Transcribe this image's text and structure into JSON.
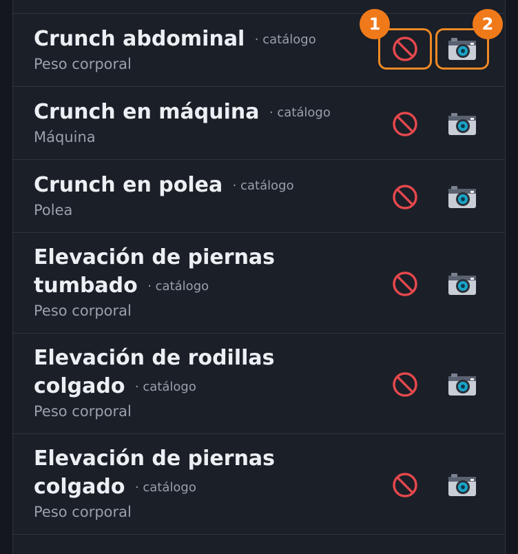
{
  "items": [
    {
      "title": "Crunch abdominal",
      "tag": "· catálogo",
      "sub": "Peso corporal"
    },
    {
      "title": "Crunch en máquina",
      "tag": "· catálogo",
      "sub": "Máquina"
    },
    {
      "title": "Crunch en polea",
      "tag": "· catálogo",
      "sub": "Polea"
    },
    {
      "title": "Elevación de piernas tumbado",
      "tag": "· catálogo",
      "sub": "Peso corporal"
    },
    {
      "title": "Elevación de rodillas colgado",
      "tag": "· catálogo",
      "sub": "Peso corporal"
    },
    {
      "title": "Elevación de piernas colgado",
      "tag": "· catálogo",
      "sub": "Peso corporal"
    }
  ],
  "annotations": {
    "badge_1": "1",
    "badge_2": "2"
  },
  "colors": {
    "background": "#1b1f27",
    "title": "#eceff3",
    "muted": "#9aa1ab",
    "highlight": "#f08a24",
    "forbid_icon": "#e5484d"
  },
  "icons": {
    "disable": "prohibited-icon",
    "photo": "camera-icon"
  }
}
